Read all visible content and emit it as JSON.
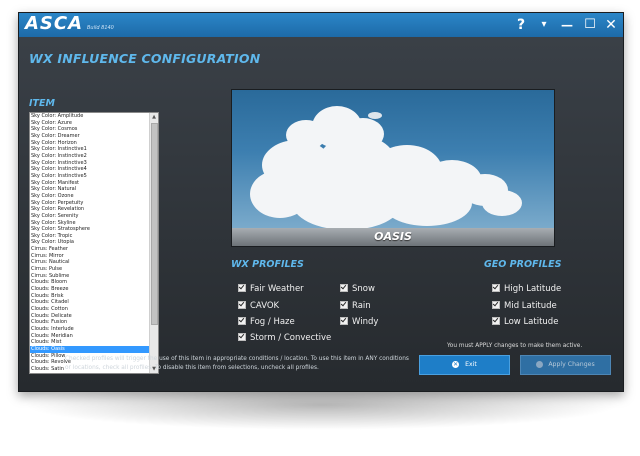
{
  "app": {
    "title": "ASCA",
    "build": "Build 8140",
    "controls": [
      "?",
      "▾",
      "—",
      "☐",
      "✕"
    ]
  },
  "page": {
    "title": "WX INFLUENCE CONFIGURATION",
    "item_label": "ITEM"
  },
  "items": [
    "Sky Color: Amplitude",
    "Sky Color: Azure",
    "Sky Color: Cosmos",
    "Sky Color: Dreamer",
    "Sky Color: Horizon",
    "Sky Color: Instinctive1",
    "Sky Color: Instinctive2",
    "Sky Color: Instinctive3",
    "Sky Color: Instinctive4",
    "Sky Color: Instinctive5",
    "Sky Color: Manifest",
    "Sky Color: Natural",
    "Sky Color: Ozone",
    "Sky Color: Perpetuity",
    "Sky Color: Revelation",
    "Sky Color: Serenity",
    "Sky Color: Skyline",
    "Sky Color: Stratosphere",
    "Sky Color: Tropic",
    "Sky Color: Utopia",
    "Cirrus: Feather",
    "Cirrus: Mirror",
    "Cirrus: Nautical",
    "Cirrus: Pulse",
    "Cirrus: Sublime",
    "Clouds: Bloom",
    "Clouds: Breeze",
    "Clouds: Brisk",
    "Clouds: Citadel",
    "Clouds: Cotton",
    "Clouds: Delicate",
    "Clouds: Fusion",
    "Clouds: Interlude",
    "Clouds: Meridian",
    "Clouds: Mist",
    "Clouds: Oasis",
    "Clouds: Pillow",
    "Clouds: Revolve",
    "Clouds: Satin"
  ],
  "selected_item": "Clouds: Oasis",
  "preview": {
    "name": "OASIS"
  },
  "wx_profiles": {
    "title": "WX PROFILES",
    "options": [
      {
        "label": "Fair Weather",
        "checked": true
      },
      {
        "label": "CAVOK",
        "checked": true
      },
      {
        "label": "Fog / Haze",
        "checked": true
      },
      {
        "label": "Storm / Convective",
        "checked": true
      },
      {
        "label": "Snow",
        "checked": true
      },
      {
        "label": "Rain",
        "checked": true
      },
      {
        "label": "Windy",
        "checked": true
      }
    ]
  },
  "geo_profiles": {
    "title": "GEO PROFILES",
    "options": [
      {
        "label": "High Latitude",
        "checked": true
      },
      {
        "label": "Mid Latitude",
        "checked": true
      },
      {
        "label": "Low Latitude",
        "checked": true
      }
    ]
  },
  "notice": "You must APPLY changes to make them active.",
  "hint": "Checked profiles will trigger the use of this item in appropriate conditions / location. To use this item in ANY conditions or locations, check all profiles. To disable this item from selections, uncheck all profiles.",
  "buttons": {
    "exit": "Exit",
    "apply": "Apply Changes"
  },
  "colors": {
    "accent": "#5fb8ec",
    "titlebar": "#1e76b8",
    "panel": "#2e3338",
    "selection": "#3399ff"
  }
}
